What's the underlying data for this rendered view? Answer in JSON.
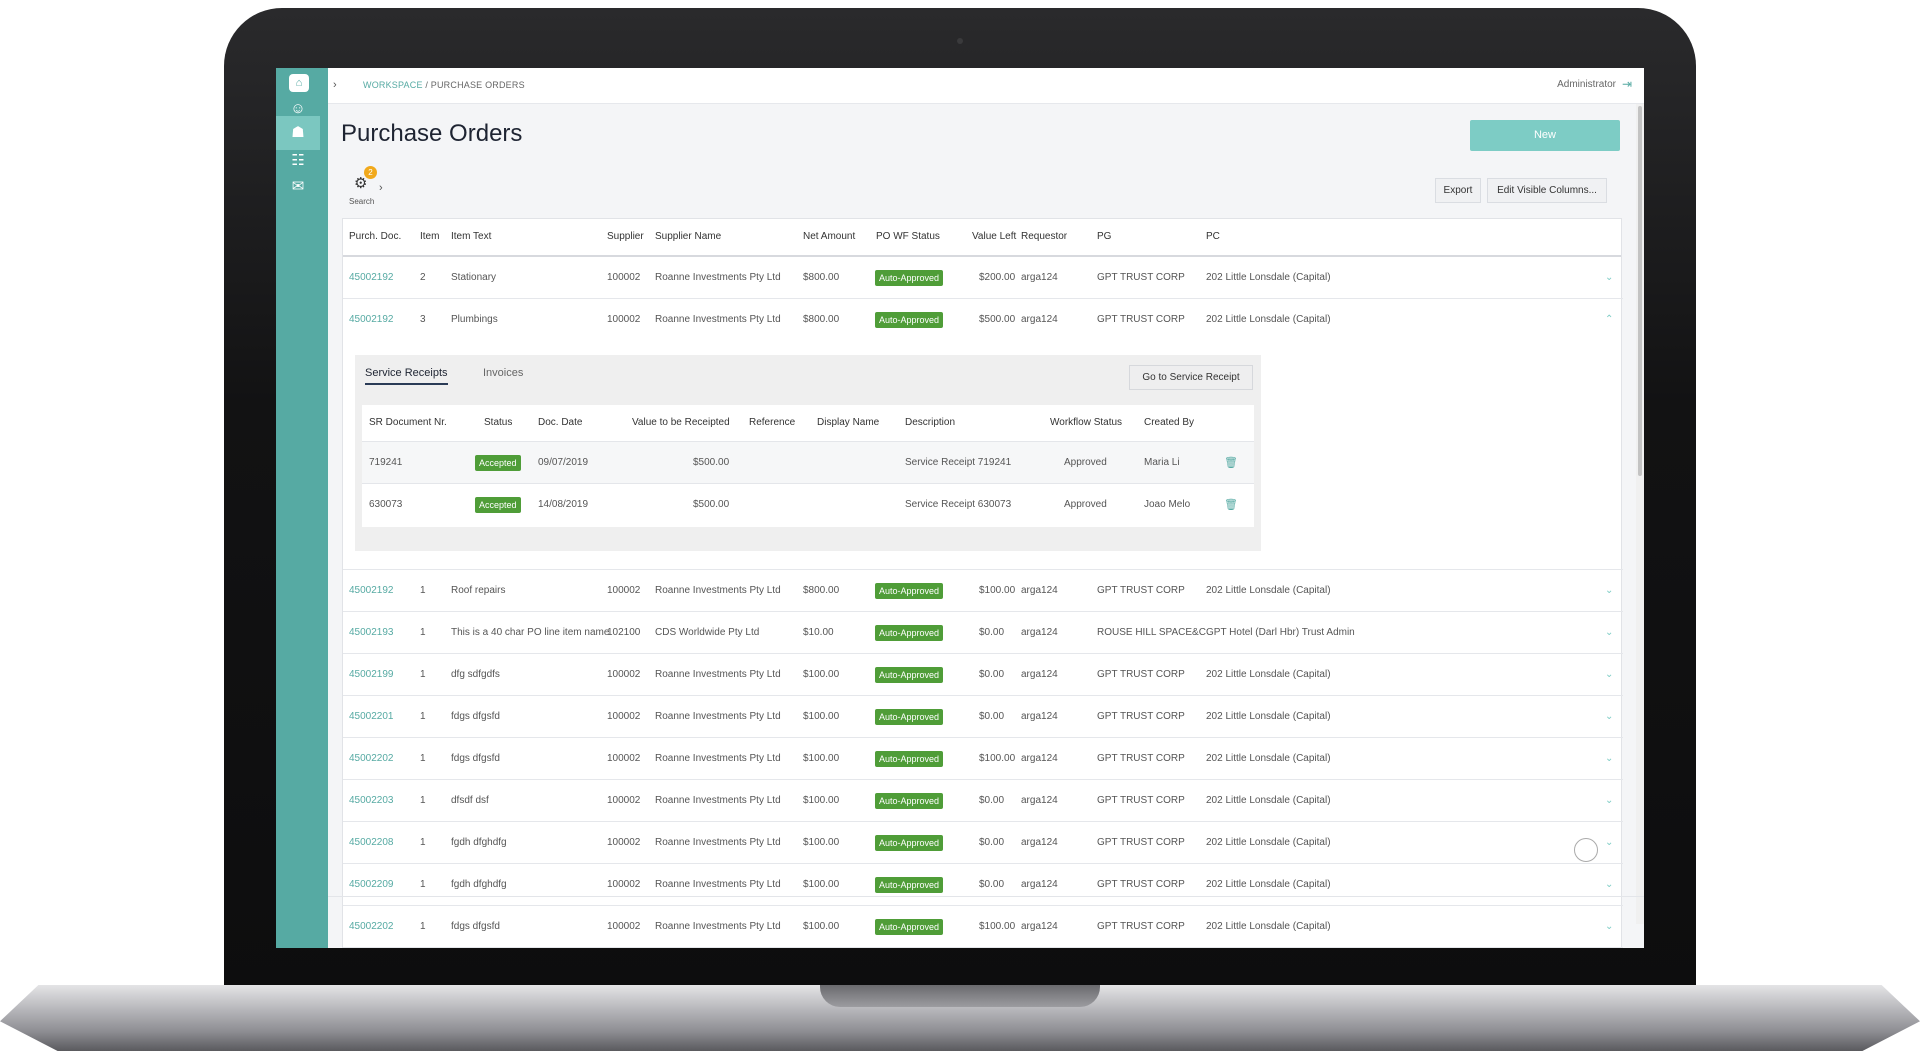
{
  "app": {
    "breadcrumb_workspace": "WORKSPACE",
    "breadcrumb_sep": " / ",
    "breadcrumb_page": "PURCHASE ORDERS",
    "user": "Administrator",
    "title": "Purchase Orders",
    "new_label": "New",
    "search_label": "Search",
    "filter_badge": "2",
    "export_label": "Export",
    "edit_columns_label": "Edit Visible Columns..."
  },
  "sidebar": {
    "logo": "⌂",
    "items": [
      {
        "icon": "☺"
      },
      {
        "icon": "☗"
      },
      {
        "icon": "☷"
      },
      {
        "icon": "✉"
      }
    ]
  },
  "columns": [
    "Purch. Doc.",
    "Item",
    "Item Text",
    "Supplier",
    "Supplier Name",
    "Net Amount",
    "PO WF Status",
    "Value Left",
    "Requestor",
    "PG",
    "PC"
  ],
  "rows": [
    {
      "doc": "45002192",
      "item": "2",
      "text": "Stationary",
      "supplier": "100002",
      "name": "Roanne Investments Pty Ltd",
      "net": "$800.00",
      "status": "Auto-Approved",
      "left": "$200.00",
      "req": "arga124",
      "pg": "GPT TRUST CORP",
      "pc": "202 Little Lonsdale (Capital)",
      "chev": "⌄"
    },
    {
      "doc": "45002192",
      "item": "3",
      "text": "Plumbings",
      "supplier": "100002",
      "name": "Roanne Investments Pty Ltd",
      "net": "$800.00",
      "status": "Auto-Approved",
      "left": "$500.00",
      "req": "arga124",
      "pg": "GPT TRUST CORP",
      "pc": "202 Little Lonsdale (Capital)",
      "chev": "⌃"
    },
    {
      "doc": "45002192",
      "item": "1",
      "text": "Roof repairs",
      "supplier": "100002",
      "name": "Roanne Investments Pty Ltd",
      "net": "$800.00",
      "status": "Auto-Approved",
      "left": "$100.00",
      "req": "arga124",
      "pg": "GPT TRUST CORP",
      "pc": "202 Little Lonsdale (Capital)",
      "chev": "⌄"
    },
    {
      "doc": "45002193",
      "item": "1",
      "text": "This is a 40 char PO line item name",
      "supplier": "102100",
      "name": "CDS Worldwide Pty Ltd",
      "net": "$10.00",
      "status": "Auto-Approved",
      "left": "$0.00",
      "req": "arga124",
      "pg": "ROUSE HILL SPACE&C",
      "pc": "GPT Hotel (Darl Hbr) Trust Admin",
      "chev": "⌄"
    },
    {
      "doc": "45002199",
      "item": "1",
      "text": "dfg sdfgdfs",
      "supplier": "100002",
      "name": "Roanne Investments Pty Ltd",
      "net": "$100.00",
      "status": "Auto-Approved",
      "left": "$0.00",
      "req": "arga124",
      "pg": "GPT TRUST CORP",
      "pc": "202 Little Lonsdale (Capital)",
      "chev": "⌄"
    },
    {
      "doc": "45002201",
      "item": "1",
      "text": "fdgs dfgsfd",
      "supplier": "100002",
      "name": "Roanne Investments Pty Ltd",
      "net": "$100.00",
      "status": "Auto-Approved",
      "left": "$0.00",
      "req": "arga124",
      "pg": "GPT TRUST CORP",
      "pc": "202 Little Lonsdale (Capital)",
      "chev": "⌄"
    },
    {
      "doc": "45002202",
      "item": "1",
      "text": "fdgs dfgsfd",
      "supplier": "100002",
      "name": "Roanne Investments Pty Ltd",
      "net": "$100.00",
      "status": "Auto-Approved",
      "left": "$100.00",
      "req": "arga124",
      "pg": "GPT TRUST CORP",
      "pc": "202 Little Lonsdale (Capital)",
      "chev": "⌄"
    },
    {
      "doc": "45002203",
      "item": "1",
      "text": "dfsdf dsf",
      "supplier": "100002",
      "name": "Roanne Investments Pty Ltd",
      "net": "$100.00",
      "status": "Auto-Approved",
      "left": "$0.00",
      "req": "arga124",
      "pg": "GPT TRUST CORP",
      "pc": "202 Little Lonsdale (Capital)",
      "chev": "⌄"
    },
    {
      "doc": "45002208",
      "item": "1",
      "text": "fgdh dfghdfg",
      "supplier": "100002",
      "name": "Roanne Investments Pty Ltd",
      "net": "$100.00",
      "status": "Auto-Approved",
      "left": "$0.00",
      "req": "arga124",
      "pg": "GPT TRUST CORP",
      "pc": "202 Little Lonsdale (Capital)",
      "chev": "⌄"
    },
    {
      "doc": "45002209",
      "item": "1",
      "text": "fgdh dfghdfg",
      "supplier": "100002",
      "name": "Roanne Investments Pty Ltd",
      "net": "$100.00",
      "status": "Auto-Approved",
      "left": "$0.00",
      "req": "arga124",
      "pg": "GPT TRUST CORP",
      "pc": "202 Little Lonsdale (Capital)",
      "chev": "⌄"
    },
    {
      "doc": "45002202",
      "item": "1",
      "text": "fdgs dfgsfd",
      "supplier": "100002",
      "name": "Roanne Investments Pty Ltd",
      "net": "$100.00",
      "status": "Auto-Approved",
      "left": "$100.00",
      "req": "arga124",
      "pg": "GPT TRUST CORP",
      "pc": "202 Little Lonsdale (Capital)",
      "chev": "⌄"
    }
  ],
  "expanded": {
    "tabs": [
      "Service Receipts",
      "Invoices"
    ],
    "go_label": "Go to Service Receipt",
    "columns": [
      "SR Document Nr.",
      "Status",
      "Doc. Date",
      "Value to be Receipted",
      "Reference",
      "Display Name",
      "Description",
      "Workflow Status",
      "Created By"
    ],
    "rows": [
      {
        "nr": "719241",
        "status": "Accepted",
        "date": "09/07/2019",
        "value": "$500.00",
        "ref": "",
        "display": "",
        "desc": "Service Receipt 719241",
        "wf": "Approved",
        "by": "Maria Li"
      },
      {
        "nr": "630073",
        "status": "Accepted",
        "date": "14/08/2019",
        "value": "$500.00",
        "ref": "",
        "display": "",
        "desc": "Service Receipt 630073",
        "wf": "Approved",
        "by": "Joao Melo"
      }
    ]
  },
  "colors": {
    "accent": "#56aaa3",
    "status_green": "#4f9d38",
    "new_button": "#7dccc5"
  }
}
